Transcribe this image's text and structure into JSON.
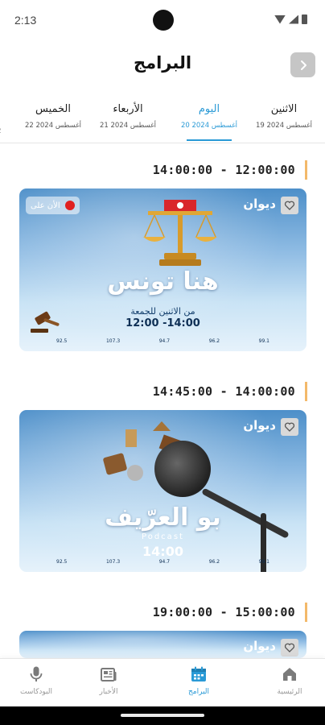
{
  "status": {
    "time": "2:13"
  },
  "header": {
    "title": "البرامج",
    "back_icon": "chevron-right-icon"
  },
  "day_tabs": [
    {
      "name": "الاثنين",
      "date": "19 أغسطس 2024",
      "active": false
    },
    {
      "name": "اليوم",
      "date": "20 أغسطس 2024",
      "active": true
    },
    {
      "name": "الأربعاء",
      "date": "21 أغسطس 2024",
      "active": false
    },
    {
      "name": "الخميس",
      "date": "22 أغسطس 2024",
      "active": false
    }
  ],
  "partial_tab_date": "2",
  "schedule": [
    {
      "time_range": "14:00:00 - 12:00:00",
      "program": {
        "title": "هنا تونس",
        "subtitle": "من الاثنين للجمعة",
        "hours": "12:00 -14:00",
        "live_label": "الأن على",
        "logo": "ديوان"
      }
    },
    {
      "time_range": "14:45:00 - 14:00:00",
      "program": {
        "title": "بو العرّيف",
        "subtitle": "Podcast",
        "hours": "14:00",
        "logo": "ديوان"
      }
    },
    {
      "time_range": "19:00:00 - 15:00:00",
      "program": {
        "logo": "ديوان"
      }
    }
  ],
  "frequencies": [
    "92.5",
    "107.3",
    "94.7",
    "96.2",
    "99.1"
  ],
  "bottom_nav": [
    {
      "label": "الرئيسية",
      "icon": "home-icon",
      "active": false
    },
    {
      "label": "البرامج",
      "icon": "calendar-icon",
      "active": true
    },
    {
      "label": "الأخبار",
      "icon": "newspaper-icon",
      "active": false
    },
    {
      "label": "البودكاست",
      "icon": "microphone-icon",
      "active": false
    }
  ],
  "colors": {
    "accent": "#2a9ad6",
    "time_marker": "#f3b96a",
    "fav_bg": "#d9d9d9"
  }
}
